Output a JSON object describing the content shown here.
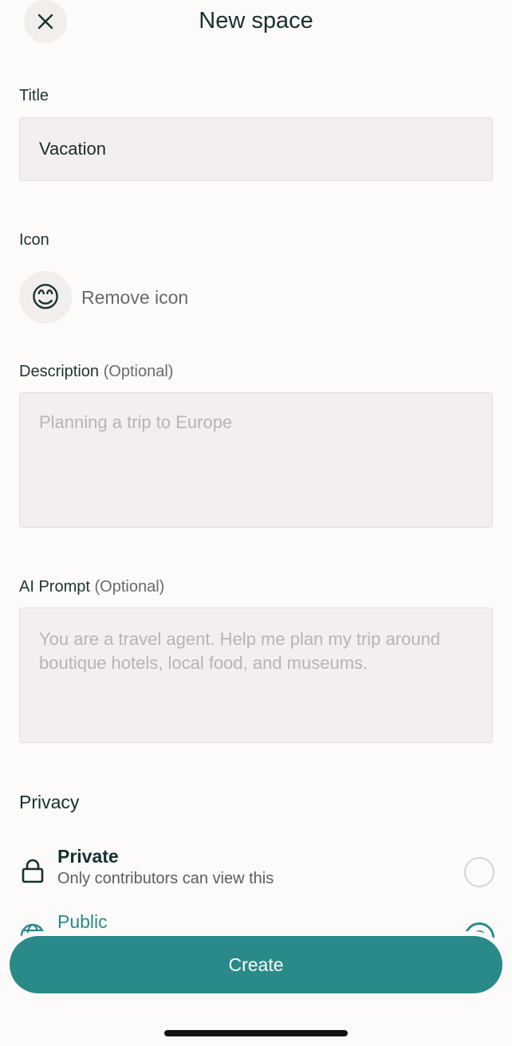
{
  "header": {
    "title": "New space",
    "close_icon": "close-icon"
  },
  "form": {
    "title_label": "Title",
    "title_value": "Vacation",
    "icon_label": "Icon",
    "icon_emoji": "😊",
    "remove_icon_label": "Remove icon",
    "description_label": "Description",
    "description_optional": "(Optional)",
    "description_placeholder": "Planning a trip to Europe",
    "ai_prompt_label": "AI Prompt",
    "ai_prompt_optional": "(Optional)",
    "ai_prompt_placeholder": "You are a travel agent. Help me plan my trip around boutique hotels, local food, and museums."
  },
  "privacy": {
    "section_title": "Privacy",
    "options": [
      {
        "title": "Private",
        "description": "Only contributors can view this",
        "icon": "lock-icon",
        "selected": false
      },
      {
        "title": "Public",
        "icon": "globe-icon",
        "selected": true
      }
    ]
  },
  "footer": {
    "create_label": "Create"
  },
  "colors": {
    "accent": "#2a8a8a",
    "field_bg": "#f3efee",
    "page_bg": "#fcfbfa"
  }
}
